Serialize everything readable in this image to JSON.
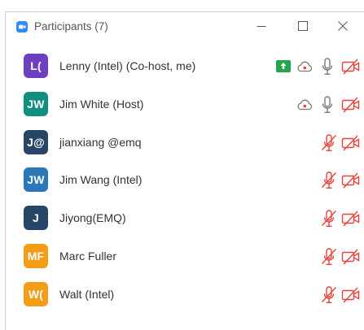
{
  "window": {
    "title": "Participants (7)",
    "controls": {
      "minimize_icon": "minimize-icon",
      "maximize_icon": "maximize-icon",
      "close_icon": "close-icon"
    }
  },
  "colors": {
    "muted_red": "#e8413c",
    "sharing_green": "#23a54a",
    "icon_gray": "#7a7a7a"
  },
  "participants": [
    {
      "initials": "L(",
      "name": "Lenny (Intel) (Co-host, me)",
      "avatar_color": "#6e3fc1",
      "sharing": true,
      "cloud": true,
      "mic": "on",
      "video": "off"
    },
    {
      "initials": "JW",
      "name": "Jim White (Host)",
      "avatar_color": "#0e8f7f",
      "sharing": false,
      "cloud": true,
      "mic": "on",
      "video": "off"
    },
    {
      "initials": "J@",
      "name": "jianxiang @emq",
      "avatar_color": "#264567",
      "sharing": false,
      "cloud": false,
      "mic": "muted",
      "video": "off"
    },
    {
      "initials": "JW",
      "name": "Jim Wang (Intel)",
      "avatar_color": "#2b78b8",
      "sharing": false,
      "cloud": false,
      "mic": "muted",
      "video": "off"
    },
    {
      "initials": "J",
      "name": "Jiyong(EMQ)",
      "avatar_color": "#264567",
      "sharing": false,
      "cloud": false,
      "mic": "muted",
      "video": "off"
    },
    {
      "initials": "MF",
      "name": "Marc Fuller",
      "avatar_color": "#f39c16",
      "sharing": false,
      "cloud": false,
      "mic": "muted",
      "video": "off"
    },
    {
      "initials": "W(",
      "name": "Walt (Intel)",
      "avatar_color": "#f39c16",
      "sharing": false,
      "cloud": false,
      "mic": "muted",
      "video": "off"
    }
  ]
}
